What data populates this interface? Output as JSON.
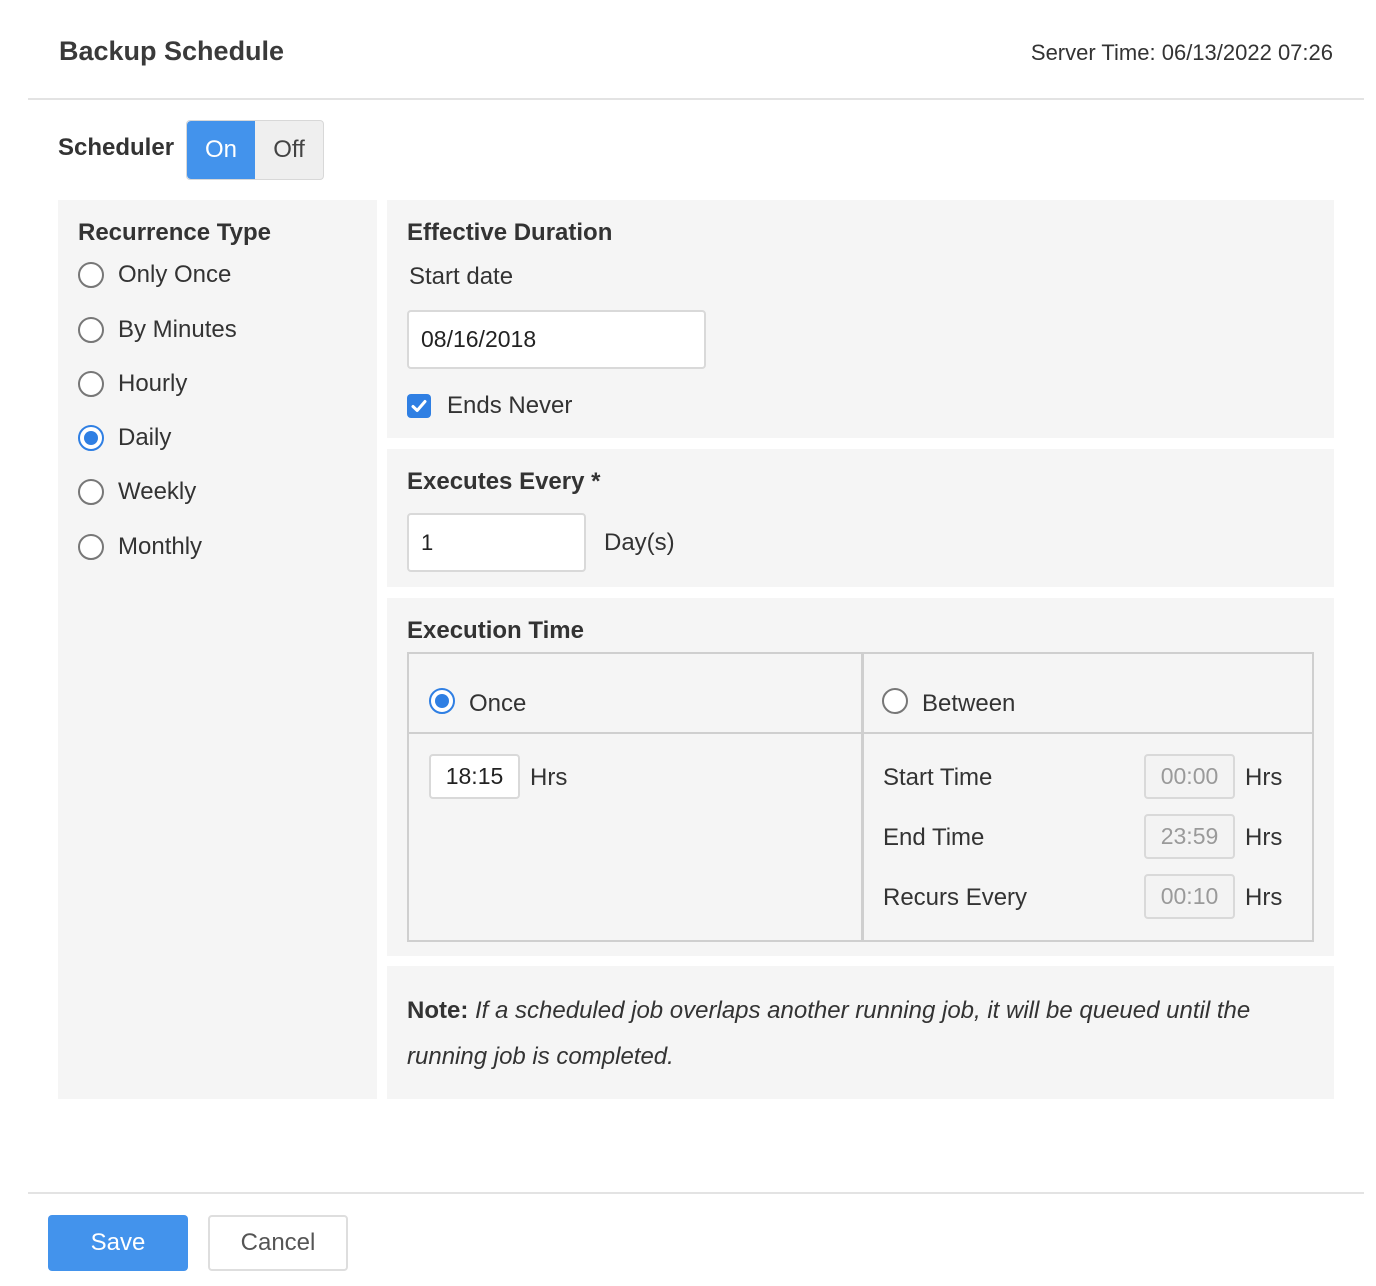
{
  "header": {
    "title": "Backup Schedule",
    "server_time_label": "Server Time:",
    "server_time_value": "06/13/2022 07:26"
  },
  "scheduler": {
    "label": "Scheduler",
    "on_label": "On",
    "off_label": "Off",
    "selected": "On"
  },
  "recurrence": {
    "heading": "Recurrence Type",
    "options": [
      {
        "label": "Only Once",
        "checked": false
      },
      {
        "label": "By Minutes",
        "checked": false
      },
      {
        "label": "Hourly",
        "checked": false
      },
      {
        "label": "Daily",
        "checked": true
      },
      {
        "label": "Weekly",
        "checked": false
      },
      {
        "label": "Monthly",
        "checked": false
      }
    ]
  },
  "effective_duration": {
    "heading": "Effective Duration",
    "start_date_label": "Start date",
    "start_date_value": "08/16/2018",
    "ends_never_label": "Ends Never",
    "ends_never_checked": true
  },
  "executes_every": {
    "heading": "Executes Every *",
    "value": "1",
    "unit": "Day(s)"
  },
  "execution_time": {
    "heading": "Execution Time",
    "once_label": "Once",
    "once_checked": true,
    "once_time": "18:15",
    "between_label": "Between",
    "between_checked": false,
    "hrs": "Hrs",
    "start_time_label": "Start Time",
    "start_time_value": "00:00",
    "end_time_label": "End Time",
    "end_time_value": "23:59",
    "recurs_every_label": "Recurs Every",
    "recurs_every_value": "00:10"
  },
  "note": {
    "prefix": "Note:",
    "text": "If a scheduled job overlaps another running job, it will be queued until the running job is completed."
  },
  "footer": {
    "save_label": "Save",
    "cancel_label": "Cancel"
  },
  "colors": {
    "accent": "#4393ec",
    "panel_bg": "#f5f5f5"
  },
  "icons": {
    "checkbox": "checkmark-icon"
  }
}
